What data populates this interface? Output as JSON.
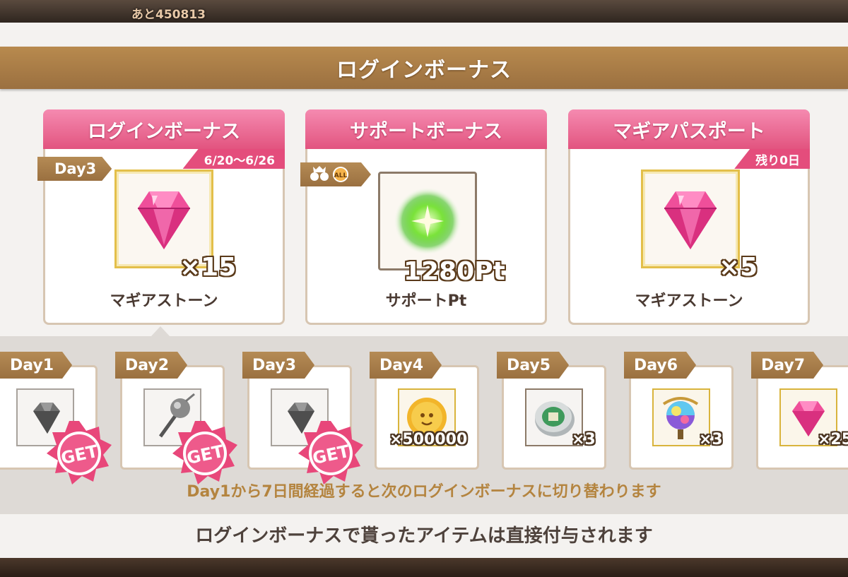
{
  "header": {
    "remaining_counter": "あと450813"
  },
  "title": "ログインボーナス",
  "cards": [
    {
      "header": "ログインボーナス",
      "tag": "6/20〜6/26",
      "day_flag": "Day3",
      "quantity": "×15",
      "item_name": "マギアストーン",
      "icon": "magia-stone-icon"
    },
    {
      "header": "サポートボーナス",
      "quantity": "1280Pt",
      "item_name": "サポートPt",
      "all_badge": "ALL",
      "icon": "support-pt-icon"
    },
    {
      "header": "マギアパスポート",
      "tag": "残り0日",
      "quantity": "×5",
      "item_name": "マギアストーン",
      "icon": "magia-stone-icon"
    }
  ],
  "days": [
    {
      "label": "Day1",
      "quantity": "",
      "got": true,
      "get_text": "GET",
      "icon": "grey-gem-icon"
    },
    {
      "label": "Day2",
      "quantity": "",
      "got": true,
      "get_text": "GET",
      "icon": "grey-staff-icon"
    },
    {
      "label": "Day3",
      "quantity": "",
      "got": true,
      "get_text": "GET",
      "icon": "grey-gem-icon"
    },
    {
      "label": "Day4",
      "quantity": "×500000",
      "got": false,
      "icon": "gold-coin-icon"
    },
    {
      "label": "Day5",
      "quantity": "×3",
      "got": false,
      "icon": "silver-coin-icon"
    },
    {
      "label": "Day6",
      "quantity": "×3",
      "got": false,
      "icon": "rainbow-orb-icon"
    },
    {
      "label": "Day7",
      "quantity": "×25",
      "got": false,
      "icon": "magia-stone-icon"
    }
  ],
  "notice_switch": "Day1から7日間経過すると次のログインボーナスに切り替わります",
  "notice_direct": "ログインボーナスで貰ったアイテムは直接付与されます",
  "colors": {
    "title_bar": "#a87c47",
    "card_header_pink": "#ea6a93",
    "day_label": "#a87c47",
    "notice_gold": "#b4843f",
    "get_badge": "#e8477a"
  }
}
